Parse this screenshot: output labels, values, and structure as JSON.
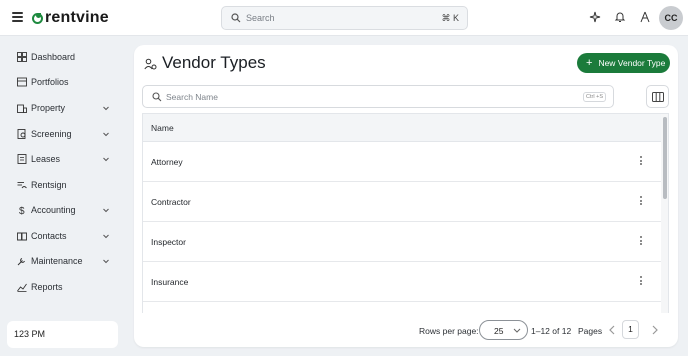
{
  "app": {
    "logo_text": "rentvine",
    "brand_color": "#1e8a3f"
  },
  "topbar": {
    "search_placeholder": "Search",
    "search_shortcut": "⌘ K",
    "icons": [
      "sparkle-icon",
      "bell-icon",
      "user-icon"
    ],
    "avatar_initials": "CC"
  },
  "sidebar": {
    "items": [
      {
        "label": "Dashboard",
        "icon": "dashboard-icon",
        "has_chevron": false
      },
      {
        "label": "Portfolios",
        "icon": "portfolios-icon",
        "has_chevron": false
      },
      {
        "label": "Property",
        "icon": "building-icon",
        "has_chevron": true
      },
      {
        "label": "Screening",
        "icon": "screening-icon",
        "has_chevron": true
      },
      {
        "label": "Leases",
        "icon": "lease-icon",
        "has_chevron": true
      },
      {
        "label": "Rentsign",
        "icon": "signature-icon",
        "has_chevron": false
      },
      {
        "label": "Accounting",
        "icon": "dollar-icon",
        "has_chevron": true
      },
      {
        "label": "Contacts",
        "icon": "book-icon",
        "has_chevron": true
      },
      {
        "label": "Maintenance",
        "icon": "wrench-icon",
        "has_chevron": true
      },
      {
        "label": "Reports",
        "icon": "chart-icon",
        "has_chevron": false
      }
    ],
    "time_box": "123 PM"
  },
  "main": {
    "title": "Vendor Types",
    "new_button_label": "New Vendor Type",
    "search_placeholder": "Search Name",
    "search_shortcut": "Ctrl +S",
    "table": {
      "columns": [
        "Name"
      ],
      "rows": [
        "Attorney",
        "Contractor",
        "Inspector",
        "Insurance",
        ""
      ]
    },
    "footer": {
      "rows_per_page_label": "Rows per page:",
      "rows_per_page_value": "25",
      "range": "1–12 of 12",
      "pages_label": "Pages",
      "current_page": "1"
    }
  }
}
